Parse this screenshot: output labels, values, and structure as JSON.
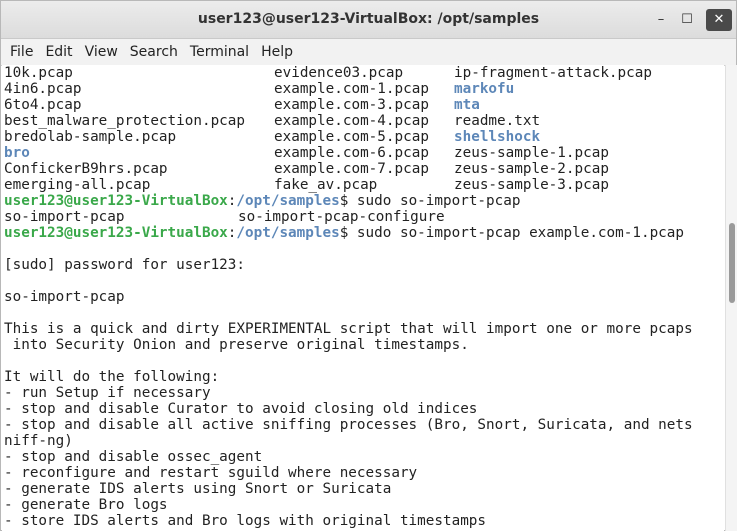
{
  "window": {
    "title": "user123@user123-VirtualBox: /opt/samples",
    "controls": {
      "minimize": "–",
      "maximize": "☐",
      "close": "✕"
    }
  },
  "menu": [
    "File",
    "Edit",
    "View",
    "Search",
    "Terminal",
    "Help"
  ],
  "terminal": {
    "ls_rows": [
      [
        {
          "t": "10k.pcap",
          "k": "file"
        },
        {
          "t": "evidence03.pcap",
          "k": "file"
        },
        {
          "t": "ip-fragment-attack.pcap",
          "k": "file"
        }
      ],
      [
        {
          "t": "4in6.pcap",
          "k": "file"
        },
        {
          "t": "example.com-1.pcap",
          "k": "file"
        },
        {
          "t": "markofu",
          "k": "dir"
        }
      ],
      [
        {
          "t": "6to4.pcap",
          "k": "file"
        },
        {
          "t": "example.com-3.pcap",
          "k": "file"
        },
        {
          "t": "mta",
          "k": "dir"
        }
      ],
      [
        {
          "t": "best_malware_protection.pcap",
          "k": "file"
        },
        {
          "t": "example.com-4.pcap",
          "k": "file"
        },
        {
          "t": "readme.txt",
          "k": "file"
        }
      ],
      [
        {
          "t": "bredolab-sample.pcap",
          "k": "file"
        },
        {
          "t": "example.com-5.pcap",
          "k": "file"
        },
        {
          "t": "shellshock",
          "k": "dir"
        }
      ],
      [
        {
          "t": "bro",
          "k": "dir"
        },
        {
          "t": "example.com-6.pcap",
          "k": "file"
        },
        {
          "t": "zeus-sample-1.pcap",
          "k": "file"
        }
      ],
      [
        {
          "t": "ConfickerB9hrs.pcap",
          "k": "file"
        },
        {
          "t": "example.com-7.pcap",
          "k": "file"
        },
        {
          "t": "zeus-sample-2.pcap",
          "k": "file"
        }
      ],
      [
        {
          "t": "emerging-all.pcap",
          "k": "file"
        },
        {
          "t": "fake_av.pcap",
          "k": "file"
        },
        {
          "t": "zeus-sample-3.pcap",
          "k": "file"
        }
      ]
    ],
    "prompt1": {
      "user": "user123@user123-VirtualBox",
      "path": "/opt/samples",
      "cmd": "$ sudo so-import-pcap"
    },
    "completion": [
      "so-import-pcap",
      "so-import-pcap-configure"
    ],
    "prompt2": {
      "user": "user123@user123-VirtualBox",
      "path": "/opt/samples",
      "cmd": "$ sudo so-import-pcap example.com-1.pcap"
    },
    "output": [
      "",
      "[sudo] password for user123:",
      "",
      "so-import-pcap",
      "",
      "This is a quick and dirty EXPERIMENTAL script that will import one or more pcaps",
      " into Security Onion and preserve original timestamps.",
      "",
      "It will do the following:",
      "- run Setup if necessary",
      "- stop and disable Curator to avoid closing old indices",
      "- stop and disable all active sniffing processes (Bro, Snort, Suricata, and nets",
      "niff-ng)",
      "- stop and disable ossec_agent",
      "- reconfigure and restart sguild where necessary",
      "- generate IDS alerts using Snort or Suricata",
      "- generate Bro logs",
      "- store IDS alerts and Bro logs with original timestamps"
    ]
  }
}
